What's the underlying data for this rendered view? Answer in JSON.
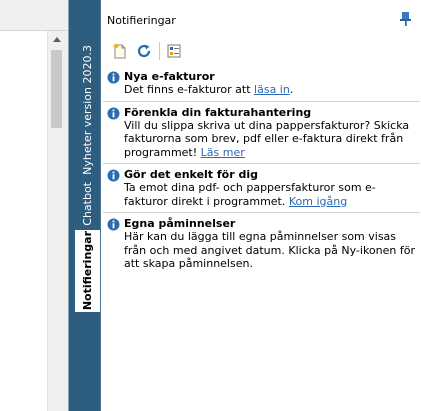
{
  "tabs": [
    {
      "label": "Nyheter version 2020.3"
    },
    {
      "label": "Chatbot"
    },
    {
      "label": "Notifieringar"
    }
  ],
  "panel": {
    "title": "Notifieringar"
  },
  "notifications": [
    {
      "title": "Nya e-fakturor",
      "text": "Det finns e-fakturor att ",
      "link": "läsa in",
      "text_after": "."
    },
    {
      "title": "Förenkla din fakturahantering",
      "text": "Vill du slippa skriva ut dina pappersfakturor? Skicka fakturorna som brev, pdf eller e-faktura direkt från programmet! ",
      "link": "Läs mer",
      "text_after": ""
    },
    {
      "title": "Gör det enkelt för dig",
      "text": "Ta emot dina pdf- och pappersfakturor som e-fakturor direkt i programmet. ",
      "link": "Kom igång",
      "text_after": ""
    },
    {
      "title": "Egna påminnelser",
      "text": "Här kan du lägga till egna påminnelser som visas från och med angivet datum. Klicka på Ny-ikonen för att skapa påminnelsen.",
      "link": "",
      "text_after": ""
    }
  ],
  "colors": {
    "tabstrip": "#2d5e80",
    "link": "#2b69b6",
    "info_icon": "#2a6cb0"
  }
}
